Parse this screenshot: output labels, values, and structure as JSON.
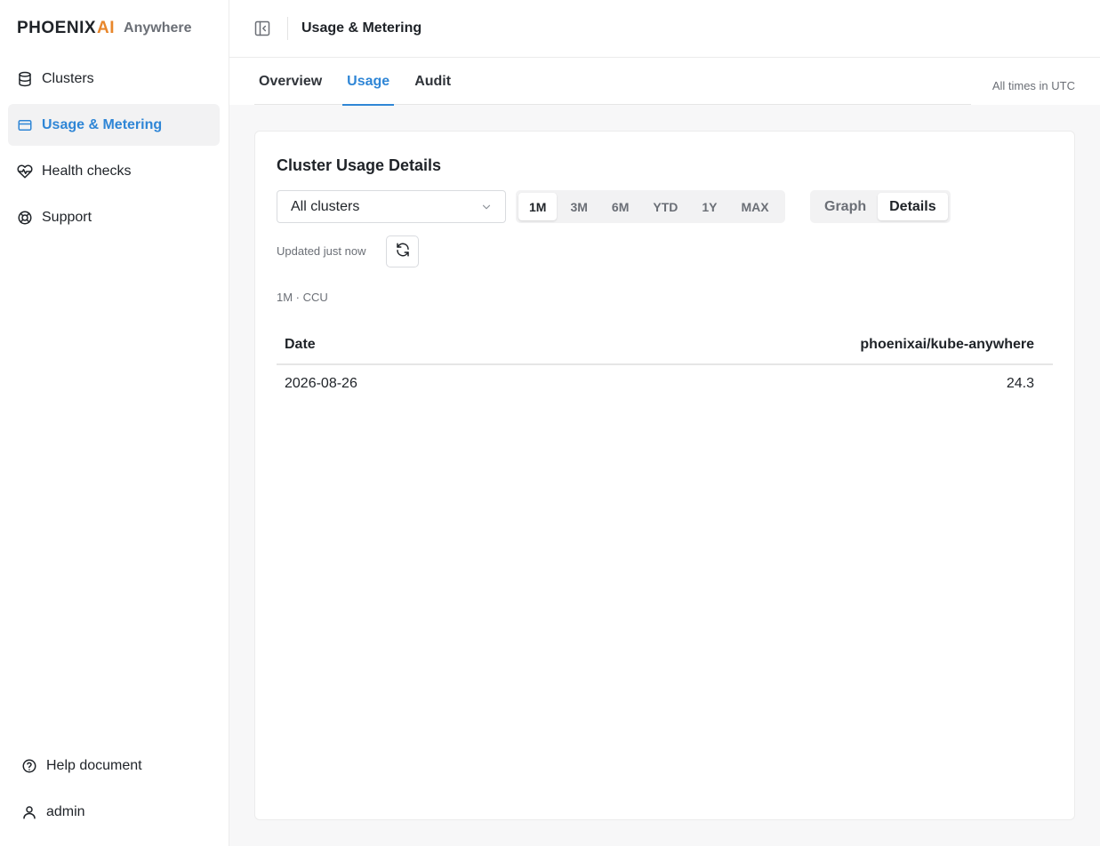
{
  "brand": {
    "wordmark_main": "PHOENIX",
    "wordmark_accent": "AI",
    "suffix": "Anywhere",
    "accent_color": "#e8862b"
  },
  "sidebar": {
    "items": [
      {
        "label": "Clusters",
        "icon": "database-icon",
        "active": false
      },
      {
        "label": "Usage & Metering",
        "icon": "credit-card-icon",
        "active": true
      },
      {
        "label": "Health checks",
        "icon": "heart-pulse-icon",
        "active": false
      },
      {
        "label": "Support",
        "icon": "lifebuoy-icon",
        "active": false
      }
    ],
    "bottom_items": [
      {
        "label": "Help document",
        "icon": "help-circle-icon"
      },
      {
        "label": "admin",
        "icon": "user-icon"
      }
    ]
  },
  "header": {
    "title": "Usage & Metering",
    "collapse_icon": "sidebar-collapse-icon"
  },
  "tabs": {
    "items": [
      {
        "label": "Overview",
        "active": false
      },
      {
        "label": "Usage",
        "active": true
      },
      {
        "label": "Audit",
        "active": false
      }
    ],
    "timezone_note": "All times in UTC"
  },
  "card": {
    "title": "Cluster Usage Details",
    "cluster_select": {
      "value": "All clusters",
      "icon": "chevron-down-icon"
    },
    "ranges": [
      {
        "label": "1M",
        "active": true
      },
      {
        "label": "3M",
        "active": false
      },
      {
        "label": "6M",
        "active": false
      },
      {
        "label": "YTD",
        "active": false
      },
      {
        "label": "1Y",
        "active": false
      },
      {
        "label": "MAX",
        "active": false
      }
    ],
    "views": [
      {
        "label": "Graph",
        "active": false
      },
      {
        "label": "Details",
        "active": true
      }
    ],
    "updated_text": "Updated just now",
    "refresh_icon": "refresh-icon",
    "range_meta": "1M · CCU",
    "table": {
      "columns": [
        "Date",
        "phoenixai/kube-anywhere"
      ],
      "rows": [
        [
          "2026-08-26",
          "24.3"
        ]
      ]
    }
  },
  "colors": {
    "accent_blue": "#2f86d6",
    "active_bg": "#f2f2f3"
  }
}
